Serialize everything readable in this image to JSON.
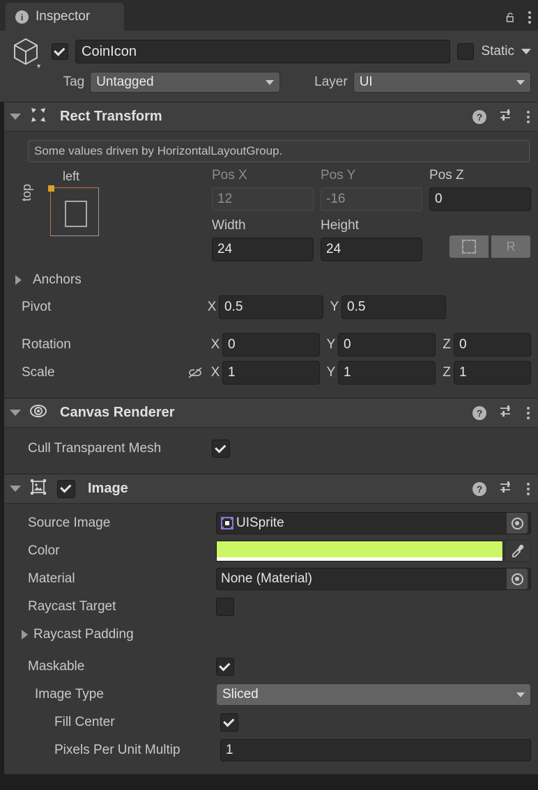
{
  "window": {
    "tab_title": "Inspector",
    "tab_icon": "info-icon",
    "lock_icon": "lock-open-icon",
    "menu_icon": "kebab-menu-icon"
  },
  "object_header": {
    "icon": "gameobject-cube-icon",
    "enabled": true,
    "name": "CoinIcon",
    "static_checked": false,
    "static_label": "Static",
    "tag_label": "Tag",
    "tag_value": "Untagged",
    "layer_label": "Layer",
    "layer_value": "UI"
  },
  "components": [
    {
      "id": "rect-transform",
      "title": "Rect Transform",
      "icon": "rect-transform-icon",
      "expanded": true,
      "help_icon": "help-icon",
      "preset_icon": "preset-sliders-icon",
      "menu_icon": "kebab-menu-icon",
      "driven_note": "Some values driven by HorizontalLayoutGroup.",
      "anchor_preview": {
        "left_label": "left",
        "top_label": "top"
      },
      "pos": [
        {
          "label": "Pos X",
          "value": "12",
          "disabled": true
        },
        {
          "label": "Pos Y",
          "value": "-16",
          "disabled": true
        },
        {
          "label": "Pos Z",
          "value": "0",
          "disabled": false
        }
      ],
      "size": [
        {
          "label": "Width",
          "value": "24",
          "disabled": false
        },
        {
          "label": "Height",
          "value": "24",
          "disabled": false
        }
      ],
      "block_buttons": [
        {
          "name": "anchor-presets-button",
          "glyph": ""
        },
        {
          "name": "blueprint-r-button",
          "glyph": "R"
        }
      ],
      "anchors_label": "Anchors",
      "pivot": {
        "label": "Pivot",
        "x_axis": "X",
        "x": "0.5",
        "y_axis": "Y",
        "y": "0.5"
      },
      "rotation": {
        "label": "Rotation",
        "x_axis": "X",
        "x": "0",
        "y_axis": "Y",
        "y": "0",
        "z_axis": "Z",
        "z": "0"
      },
      "scale": {
        "label": "Scale",
        "link_icon": "link-broken-icon",
        "x_axis": "X",
        "x": "1",
        "y_axis": "Y",
        "y": "1",
        "z_axis": "Z",
        "z": "1"
      }
    },
    {
      "id": "canvas-renderer",
      "title": "Canvas Renderer",
      "icon": "canvas-renderer-eye-icon",
      "expanded": true,
      "rows": [
        {
          "label": "Cull Transparent Mesh",
          "type": "checkbox",
          "checked": true
        }
      ]
    },
    {
      "id": "image",
      "title": "Image",
      "icon": "image-component-icon",
      "expanded": true,
      "enabled": true,
      "rows": [
        {
          "label": "Source Image",
          "type": "object",
          "value": "UISprite",
          "icon": "sprite-icon"
        },
        {
          "label": "Color",
          "type": "color",
          "value": "#CCF765",
          "alpha_bar": "#FFFFFF",
          "picker_icon": "eyedropper-icon"
        },
        {
          "label": "Material",
          "type": "object",
          "value": "None (Material)"
        },
        {
          "label": "Raycast Target",
          "type": "checkbox",
          "checked": false
        },
        {
          "label": "Raycast Padding",
          "type": "foldout"
        },
        {
          "label": "Maskable",
          "type": "checkbox",
          "checked": true
        },
        {
          "label": "Image Type",
          "type": "dropdown",
          "value": "Sliced"
        },
        {
          "label": "Fill Center",
          "type": "checkbox",
          "checked": true,
          "indent": 1
        },
        {
          "label": "Pixels Per Unit Multip",
          "type": "text",
          "value": "1",
          "indent": 2
        }
      ]
    }
  ],
  "colors": {
    "panel_bg": "#383838",
    "header_bg": "#3f3f3f",
    "field_bg": "#2a2a2a",
    "accent_green": "#CCF765",
    "anchor_orange": "#D8A12A",
    "rect_red": "#C96A5A"
  }
}
